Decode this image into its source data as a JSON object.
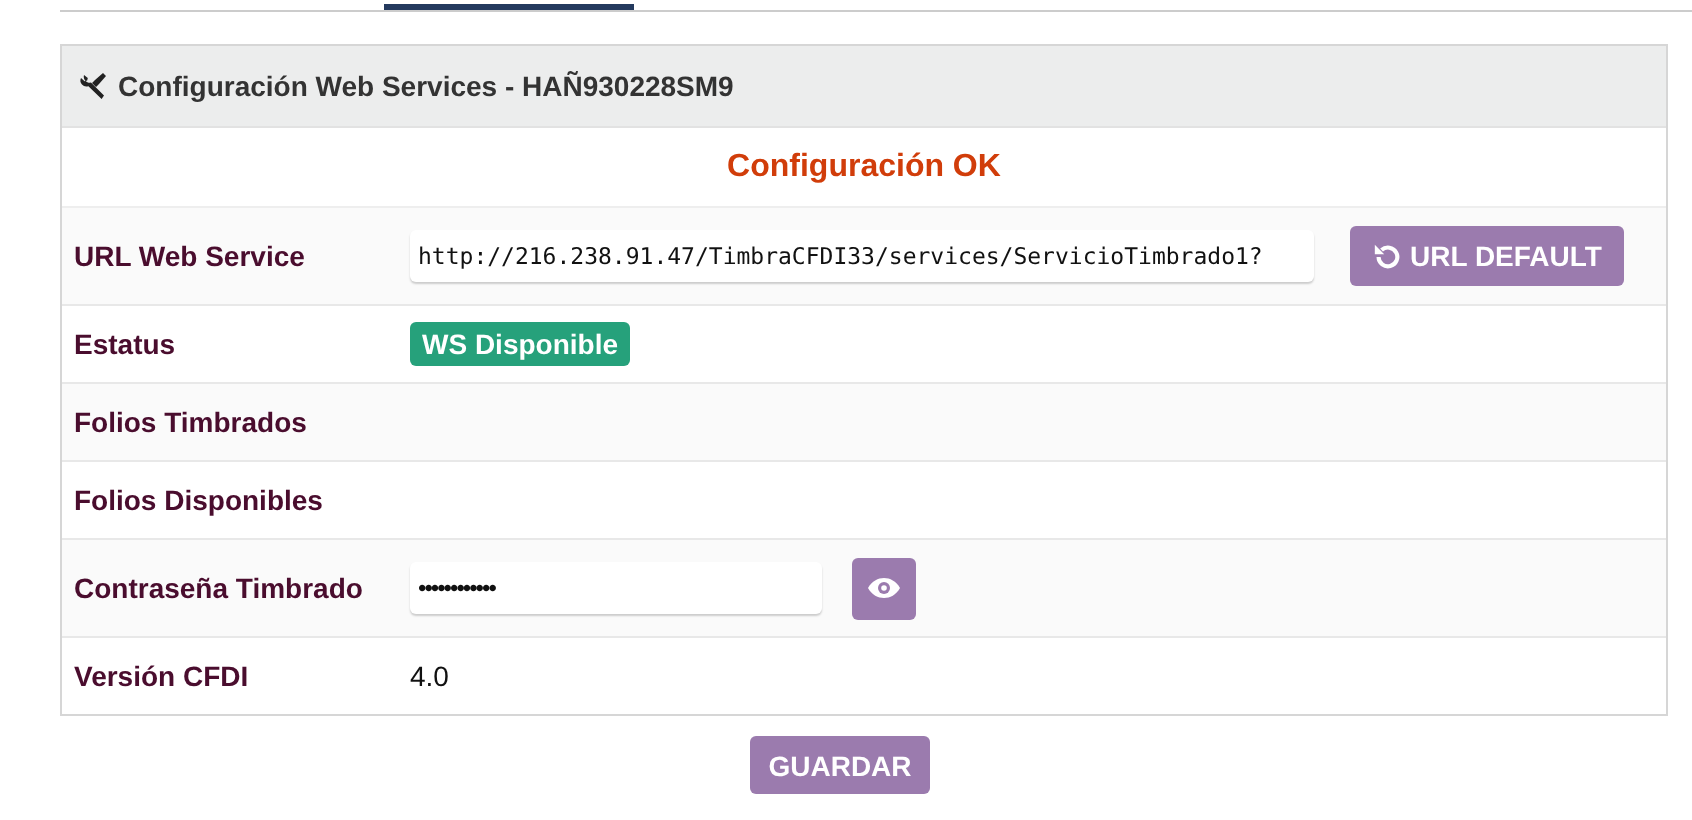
{
  "panel": {
    "title": "Configuración Web Services - HAÑ930228SM9",
    "status_message": "Configuración OK"
  },
  "fields": [
    {
      "kind": "url",
      "label": "URL Web Service",
      "value": "http://216.238.91.47/TimbraCFDI33/services/ServicioTimbrado1?",
      "button": "URL DEFAULT"
    },
    {
      "kind": "badge",
      "label": "Estatus",
      "value": "WS Disponible",
      "color": "#26a17b"
    },
    {
      "kind": "empty",
      "label": "Folios Timbrados"
    },
    {
      "kind": "empty",
      "label": "Folios Disponibles"
    },
    {
      "kind": "password",
      "label": "Contraseña Timbrado",
      "value": "••••••••••••"
    },
    {
      "kind": "text",
      "label": "Versión CFDI",
      "value": "4.0"
    }
  ],
  "save_button": "GUARDAR"
}
